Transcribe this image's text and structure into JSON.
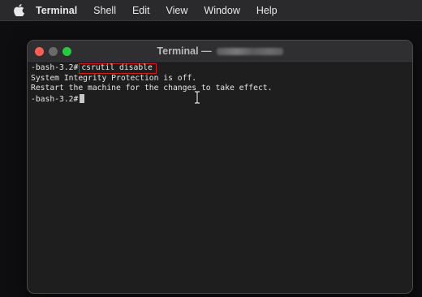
{
  "menubar": {
    "apple_icon": "apple-logo-icon",
    "items": [
      {
        "label": "Terminal"
      },
      {
        "label": "Shell"
      },
      {
        "label": "Edit"
      },
      {
        "label": "View"
      },
      {
        "label": "Window"
      },
      {
        "label": "Help"
      }
    ]
  },
  "window": {
    "title": "Terminal —",
    "title_redacted": true,
    "colors": {
      "close": "#ff5f57",
      "minimize": "#6a6a6c",
      "maximize": "#28c840"
    }
  },
  "terminal": {
    "prompt": "-bash-3.2#",
    "command": "csrutil disable",
    "output": [
      "System Integrity Protection is off.",
      "Restart the machine for the changes to take effect."
    ],
    "prompt2": "-bash-3.2#",
    "highlight_color": "#d01e1e"
  },
  "pointer": "i-beam-cursor-icon"
}
